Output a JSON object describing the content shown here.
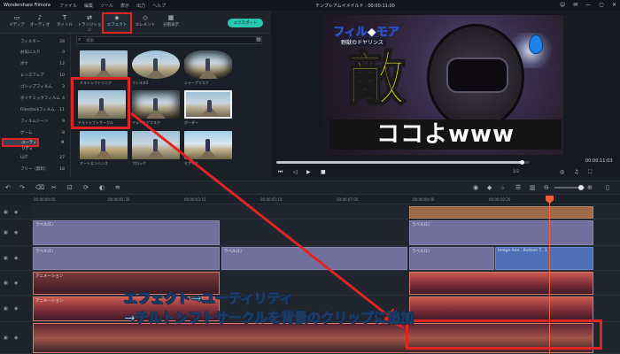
{
  "app": {
    "name": "Wondershare Filmora",
    "project_title": "テンプレアムイメイルド : 00:00:11:00",
    "menus": [
      "ファイル",
      "編集",
      "ツール",
      "表示",
      "出力",
      "ヘルプ"
    ]
  },
  "toolbar": {
    "tabs": [
      {
        "label": "メディア",
        "icon": "folder-icon"
      },
      {
        "label": "オーディオ",
        "icon": "music-icon"
      },
      {
        "label": "タイトル",
        "icon": "title-icon"
      },
      {
        "label": "トランジション",
        "icon": "transition-icon"
      },
      {
        "label": "エフェクト",
        "icon": "effect-icon"
      },
      {
        "label": "エレメント",
        "icon": "element-icon"
      },
      {
        "label": "分割表示",
        "icon": "split-icon"
      }
    ],
    "export_label": "エクスポート"
  },
  "sidebar": {
    "items": [
      {
        "label": "フィルター",
        "count": "28"
      },
      {
        "label": "お気に入り",
        "count": "0"
      },
      {
        "label": "ボケ",
        "count": "12"
      },
      {
        "label": "レンズフレア",
        "count": "10"
      },
      {
        "label": "ゴシップフィルム",
        "count": "3"
      },
      {
        "label": "ダイナミックフィルム",
        "count": "4"
      },
      {
        "label": "Filmstockフィルム",
        "count": "11"
      },
      {
        "label": "フィルムシーン",
        "count": "9"
      },
      {
        "label": "ゲーム",
        "count": "8"
      },
      {
        "label": "ユーティリティ",
        "count": "9"
      },
      {
        "label": "LUT",
        "count": "27"
      },
      {
        "label": "フリー（無料）",
        "count": "18"
      }
    ]
  },
  "search": {
    "placeholder": "検索"
  },
  "effects": [
    {
      "label": "チルトシフトリニア"
    },
    {
      "label": "フィルタ2"
    },
    {
      "label": "シャープマスク"
    },
    {
      "label": "チルトシフトサークル"
    },
    {
      "label": "フォーリゲマスク"
    },
    {
      "label": "ボーダー"
    },
    {
      "label": "オートエンハンス"
    },
    {
      "label": "ブロック"
    },
    {
      "label": "モザイク"
    }
  ],
  "preview": {
    "title_text": "フィル◆モア",
    "subtitle_text": "野獣のドヤリンス",
    "big_text": "敵",
    "bottom_text": "ココよwww",
    "timecode": "00:00:11:03",
    "ratio": "1/2",
    "progress": 0.97
  },
  "timeline": {
    "ruler_ticks": [
      "00:00:00:00",
      "00:00:01:20",
      "00:00:03:15",
      "00:00:05:10",
      "00:00:07:05",
      "00:00:09:00",
      "00:00:10:20"
    ],
    "clips": {
      "t1a": "ラベル(1)",
      "t1b": "ラベル(1)",
      "t2a": "ラベル(1)",
      "t2b": "ラベル(1)",
      "t2c": "ラベル(1)",
      "t2d": "Image Ann...Bottom T...1",
      "t3a": "アニメーション",
      "t4a": "アニメーション"
    }
  },
  "caption": {
    "line1": "エフェクト→ユーティリティ",
    "line2": "→チルトシフトサークルを背景のクリップに追加"
  },
  "colors": {
    "accent": "#29c7b0",
    "highlight": "#e02424",
    "playhead": "#f0603a"
  }
}
